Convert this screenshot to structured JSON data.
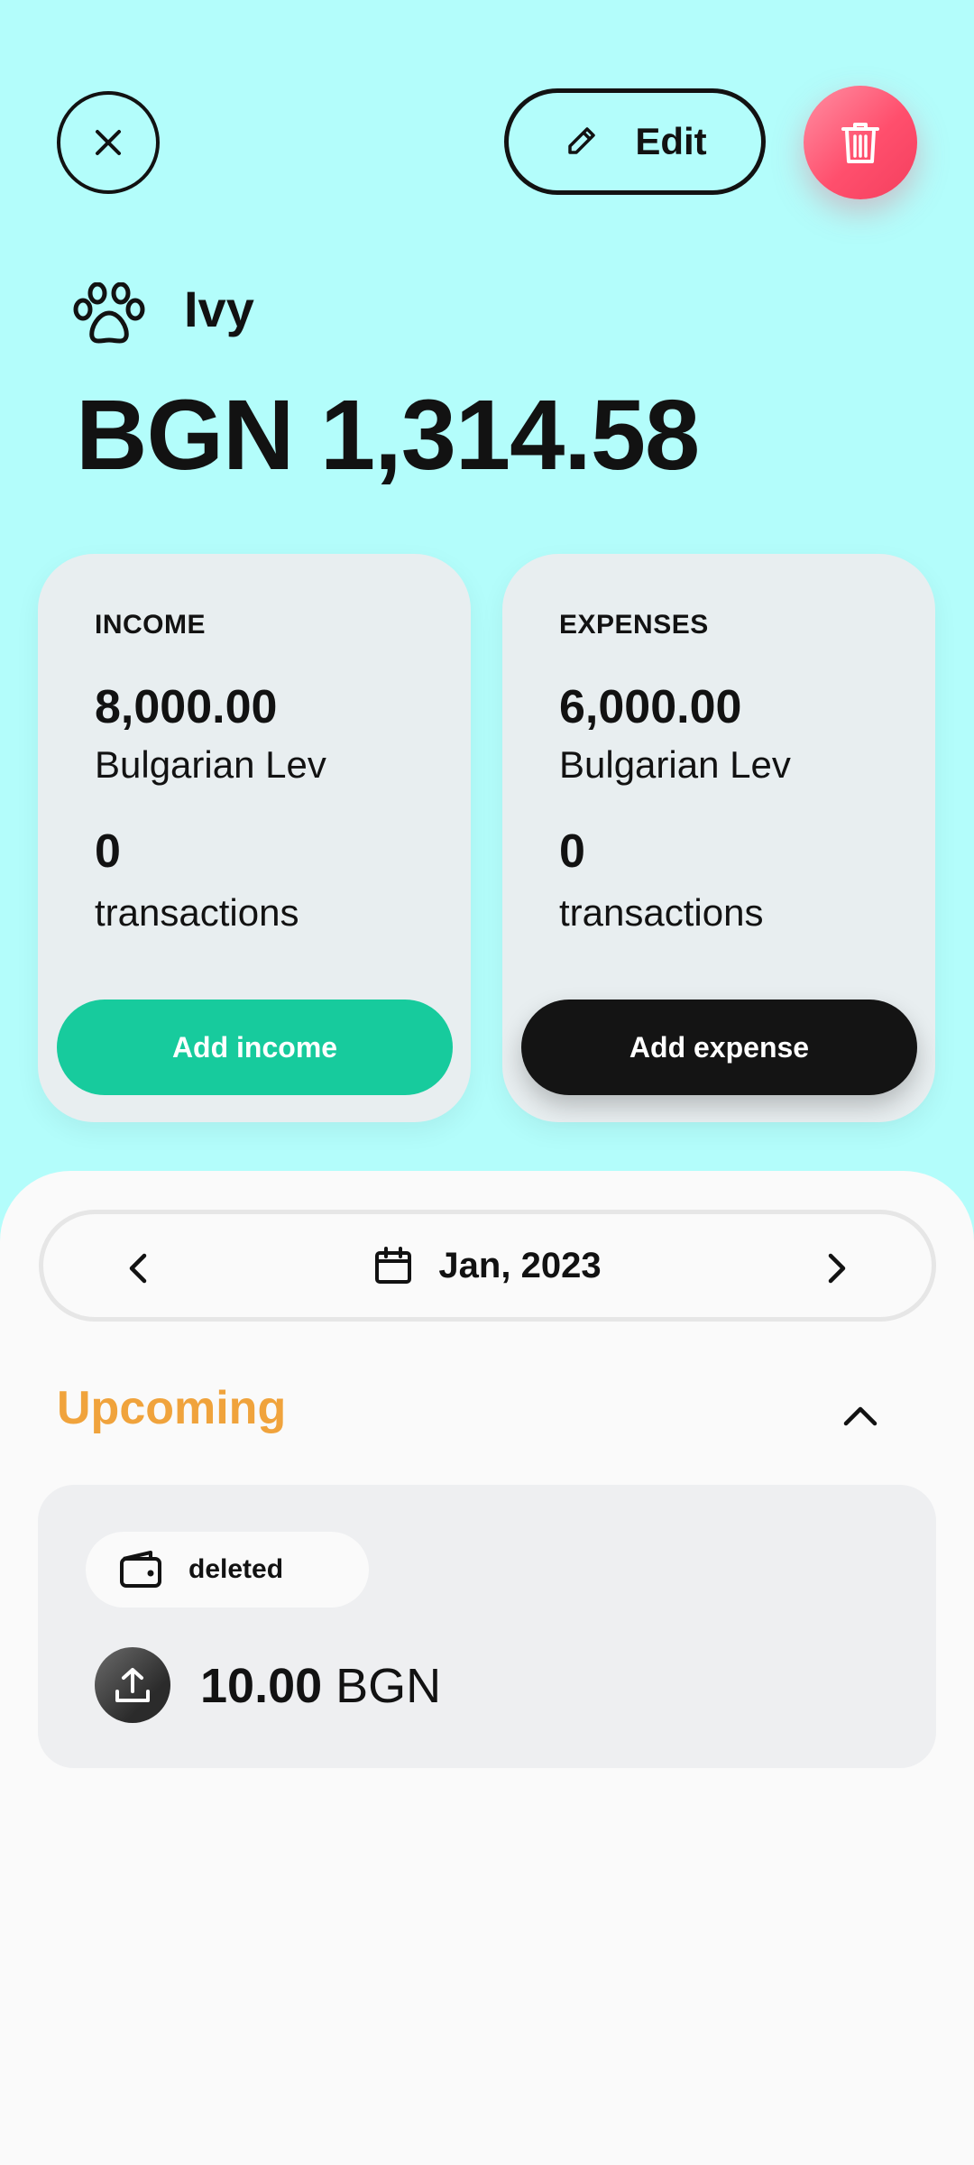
{
  "header": {
    "close_icon": "close-icon",
    "edit_label": "Edit",
    "edit_icon": "pencil-icon",
    "delete_icon": "trash-icon"
  },
  "account": {
    "icon": "paw-icon",
    "name": "Ivy",
    "balance": "BGN 1,314.58"
  },
  "income_card": {
    "label": "INCOME",
    "amount": "8,000.00",
    "currency": "Bulgarian Lev",
    "count": "0",
    "count_label": "transactions",
    "button_label": "Add income"
  },
  "expense_card": {
    "label": "EXPENSES",
    "amount": "6,000.00",
    "currency": "Bulgarian Lev",
    "count": "0",
    "count_label": "transactions",
    "button_label": "Add expense"
  },
  "month_nav": {
    "label": "Jan, 2023",
    "calendar_icon": "calendar-icon"
  },
  "upcoming": {
    "title": "Upcoming",
    "items": [
      {
        "tag_icon": "wallet-icon",
        "tag_label": "deleted",
        "type_icon": "upload-icon",
        "amount": "10.00",
        "currency": "BGN"
      }
    ]
  },
  "colors": {
    "background": "#b3fdfb",
    "income_green": "#17cb9d",
    "delete_red": "#ff4f6d",
    "upcoming_orange": "#f0a33c",
    "dark": "#121212"
  }
}
